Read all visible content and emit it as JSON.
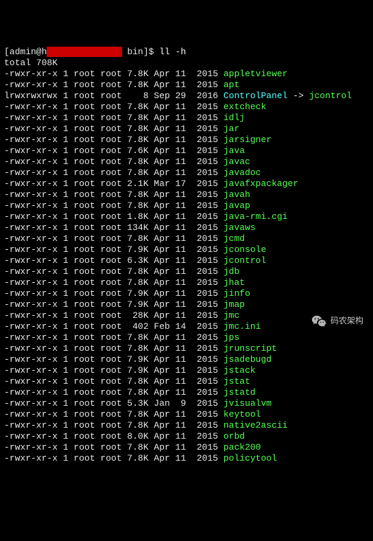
{
  "prompt": {
    "user_open": "[admin@h",
    "redacted_width": 14,
    "suffix": " bin]$ ",
    "command": "ll -h"
  },
  "total_line": "total 708K",
  "rows": [
    {
      "perm": "-rwxr-xr-x",
      "links": "1",
      "owner": "root",
      "group": "root",
      "size": "7.8K",
      "month": "Apr",
      "day": "11",
      "year": "2015",
      "name": "appletviewer",
      "color": "green"
    },
    {
      "perm": "-rwxr-xr-x",
      "links": "1",
      "owner": "root",
      "group": "root",
      "size": "7.8K",
      "month": "Apr",
      "day": "11",
      "year": "2015",
      "name": "apt",
      "color": "green"
    },
    {
      "perm": "lrwxrwxrwx",
      "links": "1",
      "owner": "root",
      "group": "root",
      "size": "8",
      "month": "Sep",
      "day": "29",
      "year": "2016",
      "name": "ControlPanel",
      "color": "cyan",
      "arrow": " -> ",
      "target": "jcontrol",
      "target_color": "green"
    },
    {
      "perm": "-rwxr-xr-x",
      "links": "1",
      "owner": "root",
      "group": "root",
      "size": "7.8K",
      "month": "Apr",
      "day": "11",
      "year": "2015",
      "name": "extcheck",
      "color": "green"
    },
    {
      "perm": "-rwxr-xr-x",
      "links": "1",
      "owner": "root",
      "group": "root",
      "size": "7.8K",
      "month": "Apr",
      "day": "11",
      "year": "2015",
      "name": "idlj",
      "color": "green"
    },
    {
      "perm": "-rwxr-xr-x",
      "links": "1",
      "owner": "root",
      "group": "root",
      "size": "7.8K",
      "month": "Apr",
      "day": "11",
      "year": "2015",
      "name": "jar",
      "color": "green"
    },
    {
      "perm": "-rwxr-xr-x",
      "links": "1",
      "owner": "root",
      "group": "root",
      "size": "7.8K",
      "month": "Apr",
      "day": "11",
      "year": "2015",
      "name": "jarsigner",
      "color": "green"
    },
    {
      "perm": "-rwxr-xr-x",
      "links": "1",
      "owner": "root",
      "group": "root",
      "size": "7.6K",
      "month": "Apr",
      "day": "11",
      "year": "2015",
      "name": "java",
      "color": "green"
    },
    {
      "perm": "-rwxr-xr-x",
      "links": "1",
      "owner": "root",
      "group": "root",
      "size": "7.8K",
      "month": "Apr",
      "day": "11",
      "year": "2015",
      "name": "javac",
      "color": "green"
    },
    {
      "perm": "-rwxr-xr-x",
      "links": "1",
      "owner": "root",
      "group": "root",
      "size": "7.8K",
      "month": "Apr",
      "day": "11",
      "year": "2015",
      "name": "javadoc",
      "color": "green"
    },
    {
      "perm": "-rwxr-xr-x",
      "links": "1",
      "owner": "root",
      "group": "root",
      "size": "2.1K",
      "month": "Mar",
      "day": "17",
      "year": "2015",
      "name": "javafxpackager",
      "color": "green"
    },
    {
      "perm": "-rwxr-xr-x",
      "links": "1",
      "owner": "root",
      "group": "root",
      "size": "7.8K",
      "month": "Apr",
      "day": "11",
      "year": "2015",
      "name": "javah",
      "color": "green"
    },
    {
      "perm": "-rwxr-xr-x",
      "links": "1",
      "owner": "root",
      "group": "root",
      "size": "7.8K",
      "month": "Apr",
      "day": "11",
      "year": "2015",
      "name": "javap",
      "color": "green"
    },
    {
      "perm": "-rwxr-xr-x",
      "links": "1",
      "owner": "root",
      "group": "root",
      "size": "1.8K",
      "month": "Apr",
      "day": "11",
      "year": "2015",
      "name": "java-rmi.cgi",
      "color": "green"
    },
    {
      "perm": "-rwxr-xr-x",
      "links": "1",
      "owner": "root",
      "group": "root",
      "size": "134K",
      "month": "Apr",
      "day": "11",
      "year": "2015",
      "name": "javaws",
      "color": "green"
    },
    {
      "perm": "-rwxr-xr-x",
      "links": "1",
      "owner": "root",
      "group": "root",
      "size": "7.8K",
      "month": "Apr",
      "day": "11",
      "year": "2015",
      "name": "jcmd",
      "color": "green"
    },
    {
      "perm": "-rwxr-xr-x",
      "links": "1",
      "owner": "root",
      "group": "root",
      "size": "7.9K",
      "month": "Apr",
      "day": "11",
      "year": "2015",
      "name": "jconsole",
      "color": "green"
    },
    {
      "perm": "-rwxr-xr-x",
      "links": "1",
      "owner": "root",
      "group": "root",
      "size": "6.3K",
      "month": "Apr",
      "day": "11",
      "year": "2015",
      "name": "jcontrol",
      "color": "green"
    },
    {
      "perm": "-rwxr-xr-x",
      "links": "1",
      "owner": "root",
      "group": "root",
      "size": "7.8K",
      "month": "Apr",
      "day": "11",
      "year": "2015",
      "name": "jdb",
      "color": "green"
    },
    {
      "perm": "-rwxr-xr-x",
      "links": "1",
      "owner": "root",
      "group": "root",
      "size": "7.8K",
      "month": "Apr",
      "day": "11",
      "year": "2015",
      "name": "jhat",
      "color": "green"
    },
    {
      "perm": "-rwxr-xr-x",
      "links": "1",
      "owner": "root",
      "group": "root",
      "size": "7.9K",
      "month": "Apr",
      "day": "11",
      "year": "2015",
      "name": "jinfo",
      "color": "green"
    },
    {
      "perm": "-rwxr-xr-x",
      "links": "1",
      "owner": "root",
      "group": "root",
      "size": "7.9K",
      "month": "Apr",
      "day": "11",
      "year": "2015",
      "name": "jmap",
      "color": "green"
    },
    {
      "perm": "-rwxr-xr-x",
      "links": "1",
      "owner": "root",
      "group": "root",
      "size": "28K",
      "month": "Apr",
      "day": "11",
      "year": "2015",
      "name": "jmc",
      "color": "green"
    },
    {
      "perm": "-rwxr-xr-x",
      "links": "1",
      "owner": "root",
      "group": "root",
      "size": "402",
      "month": "Feb",
      "day": "14",
      "year": "2015",
      "name": "jmc.ini",
      "color": "green"
    },
    {
      "perm": "-rwxr-xr-x",
      "links": "1",
      "owner": "root",
      "group": "root",
      "size": "7.8K",
      "month": "Apr",
      "day": "11",
      "year": "2015",
      "name": "jps",
      "color": "green"
    },
    {
      "perm": "-rwxr-xr-x",
      "links": "1",
      "owner": "root",
      "group": "root",
      "size": "7.8K",
      "month": "Apr",
      "day": "11",
      "year": "2015",
      "name": "jrunscript",
      "color": "green"
    },
    {
      "perm": "-rwxr-xr-x",
      "links": "1",
      "owner": "root",
      "group": "root",
      "size": "7.9K",
      "month": "Apr",
      "day": "11",
      "year": "2015",
      "name": "jsadebugd",
      "color": "green"
    },
    {
      "perm": "-rwxr-xr-x",
      "links": "1",
      "owner": "root",
      "group": "root",
      "size": "7.9K",
      "month": "Apr",
      "day": "11",
      "year": "2015",
      "name": "jstack",
      "color": "green"
    },
    {
      "perm": "-rwxr-xr-x",
      "links": "1",
      "owner": "root",
      "group": "root",
      "size": "7.8K",
      "month": "Apr",
      "day": "11",
      "year": "2015",
      "name": "jstat",
      "color": "green"
    },
    {
      "perm": "-rwxr-xr-x",
      "links": "1",
      "owner": "root",
      "group": "root",
      "size": "7.8K",
      "month": "Apr",
      "day": "11",
      "year": "2015",
      "name": "jstatd",
      "color": "green"
    },
    {
      "perm": "-rwxr-xr-x",
      "links": "1",
      "owner": "root",
      "group": "root",
      "size": "5.3K",
      "month": "Jan",
      "day": "9",
      "year": "2015",
      "name": "jvisualvm",
      "color": "green"
    },
    {
      "perm": "-rwxr-xr-x",
      "links": "1",
      "owner": "root",
      "group": "root",
      "size": "7.8K",
      "month": "Apr",
      "day": "11",
      "year": "2015",
      "name": "keytool",
      "color": "green"
    },
    {
      "perm": "-rwxr-xr-x",
      "links": "1",
      "owner": "root",
      "group": "root",
      "size": "7.8K",
      "month": "Apr",
      "day": "11",
      "year": "2015",
      "name": "native2ascii",
      "color": "green"
    },
    {
      "perm": "-rwxr-xr-x",
      "links": "1",
      "owner": "root",
      "group": "root",
      "size": "8.0K",
      "month": "Apr",
      "day": "11",
      "year": "2015",
      "name": "orbd",
      "color": "green"
    },
    {
      "perm": "-rwxr-xr-x",
      "links": "1",
      "owner": "root",
      "group": "root",
      "size": "7.8K",
      "month": "Apr",
      "day": "11",
      "year": "2015",
      "name": "pack200",
      "color": "green"
    },
    {
      "perm": "-rwxr-xr-x",
      "links": "1",
      "owner": "root",
      "group": "root",
      "size": "7.8K",
      "month": "Apr",
      "day": "11",
      "year": "2015",
      "name": "policytool",
      "color": "green"
    }
  ],
  "watermark": {
    "text": "码农架构"
  }
}
